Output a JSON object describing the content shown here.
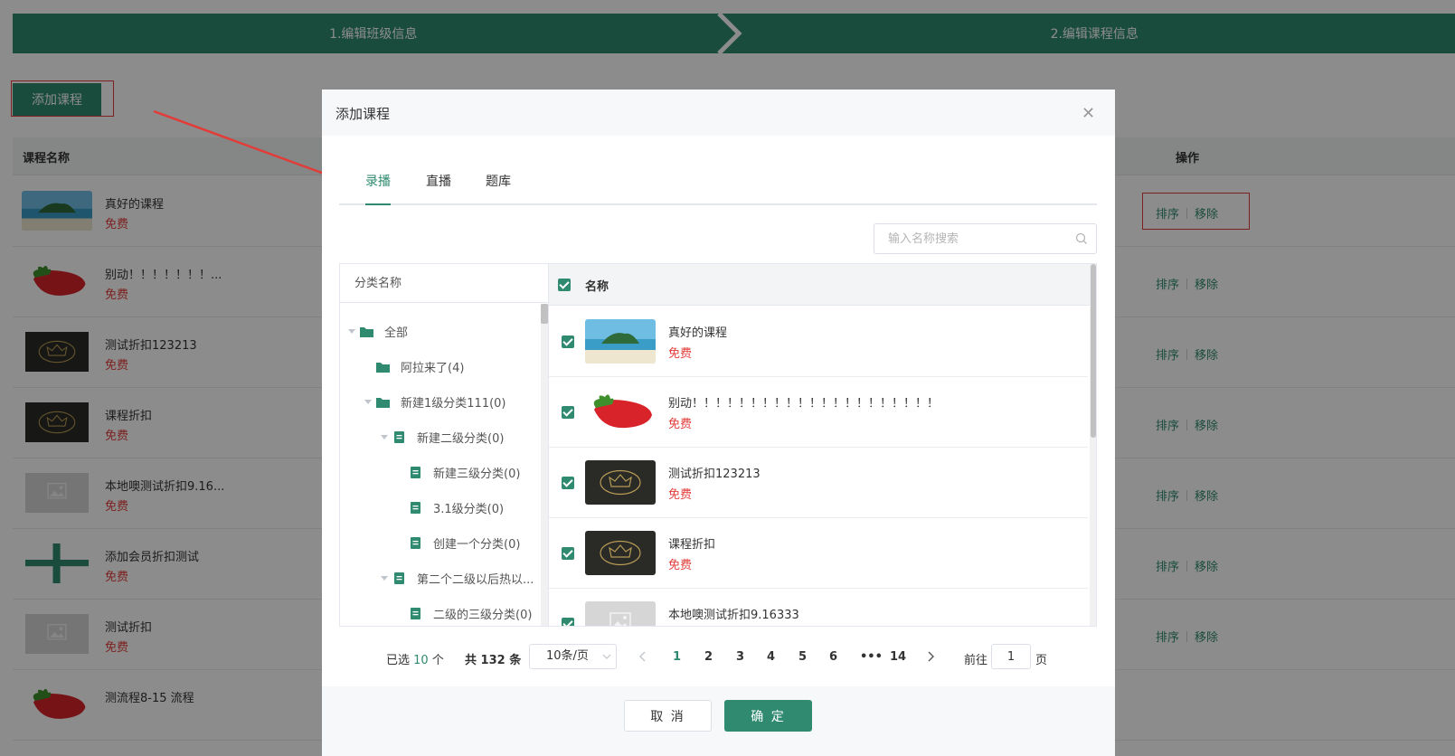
{
  "steps": [
    "1.编辑班级信息",
    "2.编辑课程信息"
  ],
  "add_course_button": "添加课程",
  "table": {
    "col_name": "课程名称",
    "col_ops": "操作",
    "rows": [
      {
        "title": "真好的课程",
        "price": "免费",
        "thumb": "sea-island-image"
      },
      {
        "title": "别动！！！！！！！...",
        "price": "免费",
        "thumb": "strawberry-image"
      },
      {
        "title": "测试折扣123213",
        "price": "免费",
        "thumb": "crown-image"
      },
      {
        "title": "课程折扣",
        "price": "免费",
        "thumb": "crown-image"
      },
      {
        "title": "本地噢测试折扣9.16...",
        "price": "免费",
        "thumb": "image-placeholder"
      },
      {
        "title": "添加会员折扣测试",
        "price": "免费",
        "thumb": "plus-image"
      },
      {
        "title": "测试折扣",
        "price": "免费",
        "thumb": "image-placeholder"
      },
      {
        "title": "测流程8-15 流程",
        "price": "",
        "thumb": "strawberry-image"
      }
    ],
    "op_sort": "排序",
    "op_remove": "移除"
  },
  "modal": {
    "title": "添加课程",
    "close_icon": "close-icon",
    "tabs": [
      "录播",
      "直播",
      "题库"
    ],
    "active_tab": "录播",
    "search_placeholder": "输入名称搜索",
    "tree": {
      "header": "分类名称",
      "items": [
        {
          "label": "全部",
          "level": 0,
          "icon": "folder-icon",
          "expanded": true
        },
        {
          "label": "阿拉来了(4)",
          "level": 1,
          "icon": "folder-icon",
          "expanded": null
        },
        {
          "label": "新建1级分类111(0)",
          "level": 1,
          "icon": "folder-icon",
          "expanded": true
        },
        {
          "label": "新建二级分类(0)",
          "level": 2,
          "icon": "document-icon",
          "expanded": true
        },
        {
          "label": "新建三级分类(0)",
          "level": 3,
          "icon": "document-icon",
          "expanded": null
        },
        {
          "label": "3.1级分类(0)",
          "level": 3,
          "icon": "document-icon",
          "expanded": null
        },
        {
          "label": "创建一个分类(0)",
          "level": 3,
          "icon": "document-icon",
          "expanded": null
        },
        {
          "label": "第二个二级以后热以...",
          "level": 2,
          "icon": "document-icon",
          "expanded": true
        },
        {
          "label": "二级的三级分类(0)",
          "level": 3,
          "icon": "document-icon",
          "expanded": null
        }
      ]
    },
    "list": {
      "header": "名称",
      "rows": [
        {
          "title": "真好的课程",
          "price": "免费",
          "checked": true,
          "thumb": "sea-island-image"
        },
        {
          "title": "别动！！！！！！！！！！！！！！！！！！！！！",
          "price": "免费",
          "checked": true,
          "thumb": "strawberry-image"
        },
        {
          "title": "测试折扣123213",
          "price": "免费",
          "checked": true,
          "thumb": "crown-image"
        },
        {
          "title": "课程折扣",
          "price": "免费",
          "checked": true,
          "thumb": "crown-image"
        },
        {
          "title": "本地噢测试折扣9.16333",
          "price": "",
          "checked": true,
          "thumb": "image-placeholder"
        }
      ]
    },
    "pagination": {
      "selected_prefix": "已选",
      "selected_count": "10",
      "selected_suffix": "个",
      "total": "共 132 条",
      "page_size": "10条/页",
      "pages": [
        "1",
        "2",
        "3",
        "4",
        "5",
        "6",
        "•••",
        "14"
      ],
      "current_page": "1",
      "goto_prefix": "前往",
      "goto_value": "1",
      "goto_suffix": "页"
    },
    "cancel_button": "取 消",
    "confirm_button": "确 定"
  },
  "colors": {
    "primary": "#2f8a6f",
    "danger": "#e23c39",
    "annotation_red": "#e23c39"
  }
}
